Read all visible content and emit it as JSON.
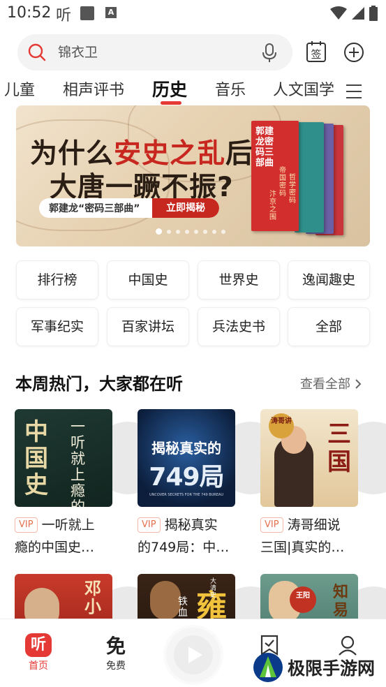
{
  "status_bar": {
    "time": "10:52",
    "app_glyph": "听",
    "a_badge": "A"
  },
  "search": {
    "placeholder": "锦衣卫"
  },
  "header": {
    "sign_label": "签"
  },
  "tabs": [
    {
      "label": "儿童"
    },
    {
      "label": "相声评书"
    },
    {
      "label": "历史",
      "active": true
    },
    {
      "label": "音乐"
    },
    {
      "label": "人文国学"
    }
  ],
  "banner": {
    "title_line1_a": "为什么",
    "title_line1_b": "安史之乱",
    "title_line1_c": "后",
    "title_line2": "大唐一蹶不振?",
    "pill_text": "郭建龙“密码三部曲”",
    "pill_button": "立即揭秘",
    "book_title": "郭建龙密码三部曲",
    "book_subtitles": [
      "帝国密码",
      "哲学密码",
      "汴京之围"
    ],
    "dot_count": 8,
    "active_dot": 0
  },
  "categories": [
    {
      "label": "排行榜"
    },
    {
      "label": "中国史"
    },
    {
      "label": "世界史"
    },
    {
      "label": "逸闻趣史"
    },
    {
      "label": "军事纪实"
    },
    {
      "label": "百家讲坛"
    },
    {
      "label": "兵法史书"
    },
    {
      "label": "全部"
    }
  ],
  "section": {
    "title": "本周热门，大家都在听",
    "more": "查看全部"
  },
  "cards": [
    {
      "vip": "VIP",
      "title_line1": "一听就上",
      "title_line2": "瘾的中国史…",
      "cover_text": "中国史",
      "cover_side": "一听就上瘾的"
    },
    {
      "vip": "VIP",
      "title_line1": "揭秘真实",
      "title_line2": "的749局：中…",
      "cover_text": "揭秘真实的",
      "cover_big": "749局",
      "cover_sub": "UNCOVER SECRETS FOR THE 749 BUREAU"
    },
    {
      "vip": "VIP",
      "title_line1": "涛哥细说",
      "title_line2": "三国|真实的…",
      "cover_text": "三国",
      "cover_badge": "涛哥讲"
    },
    {
      "cover_text": "邓小"
    },
    {
      "cover_text": "雍",
      "cover_side": "铁血",
      "cover_badge": "大清史"
    },
    {
      "cover_text": "王阳",
      "cover_side": "知易"
    }
  ],
  "bottom_nav": [
    {
      "label": "首页",
      "icon": "听",
      "active": true
    },
    {
      "label": "免费",
      "icon": "免"
    },
    {
      "label": "",
      "icon": "play"
    },
    {
      "label": "",
      "icon": "check"
    },
    {
      "label": "",
      "icon": "user"
    }
  ],
  "watermark": {
    "text": "极限手游网"
  },
  "colors": {
    "accent": "#e53935",
    "vip": "#e8704d",
    "banner_red": "#c62820"
  }
}
